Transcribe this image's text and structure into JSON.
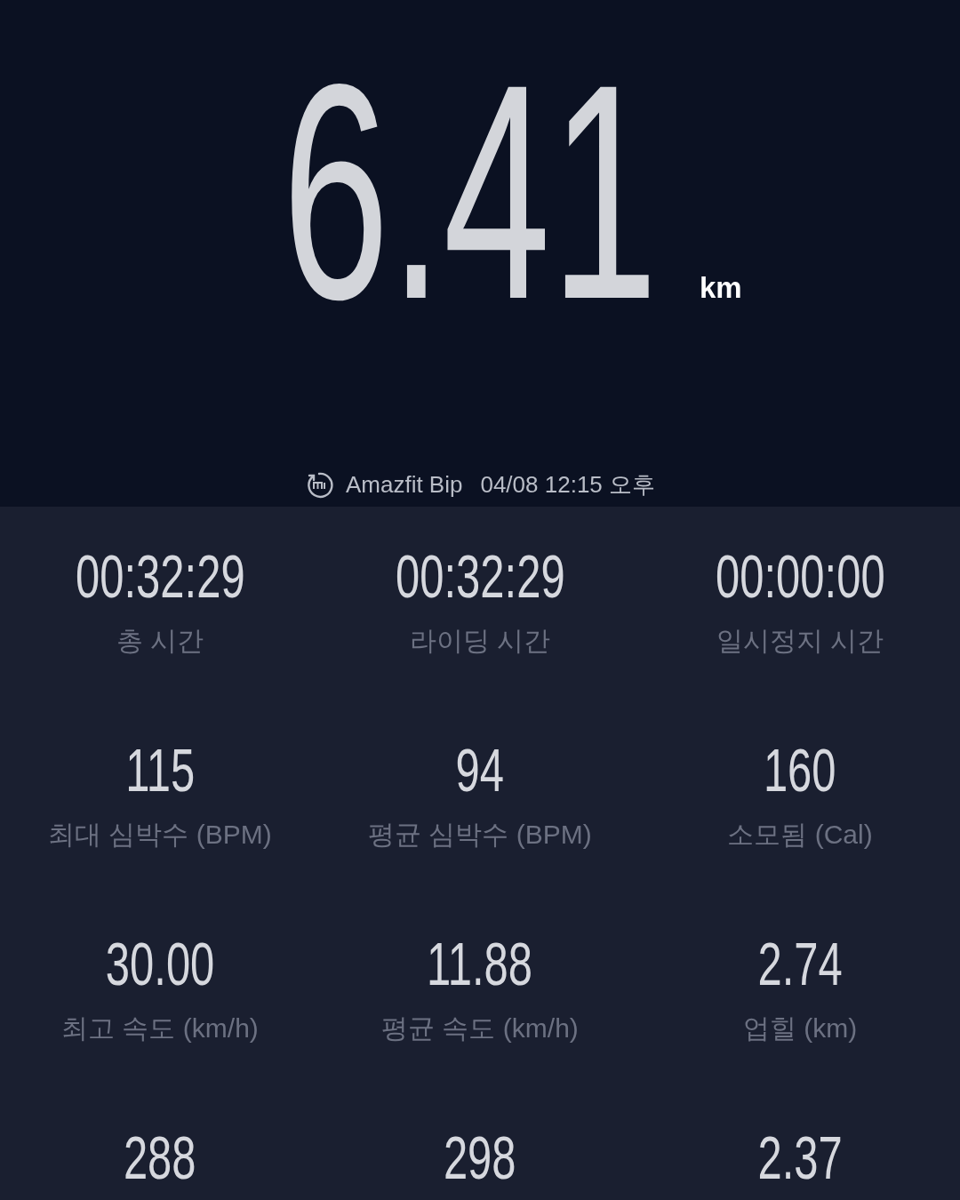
{
  "distance": {
    "value": "6.41",
    "unit": "km"
  },
  "source": {
    "device": "Amazfit Bip",
    "datetime": "04/08 12:15 오후"
  },
  "stats": [
    {
      "value": "00:32:29",
      "label": "총 시간"
    },
    {
      "value": "00:32:29",
      "label": "라이딩 시간"
    },
    {
      "value": "00:00:00",
      "label": "일시정지 시간"
    },
    {
      "value": "115",
      "label": "최대 심박수 (BPM)"
    },
    {
      "value": "94",
      "label": "평균 심박수 (BPM)"
    },
    {
      "value": "160",
      "label": "소모됨 (Cal)"
    },
    {
      "value": "30.00",
      "label": "최고 속도 (km/h)"
    },
    {
      "value": "11.88",
      "label": "평균 속도 (km/h)"
    },
    {
      "value": "2.74",
      "label": "업힐 (km)"
    },
    {
      "value": "288"
    },
    {
      "value": "298"
    },
    {
      "value": "2.37"
    }
  ]
}
